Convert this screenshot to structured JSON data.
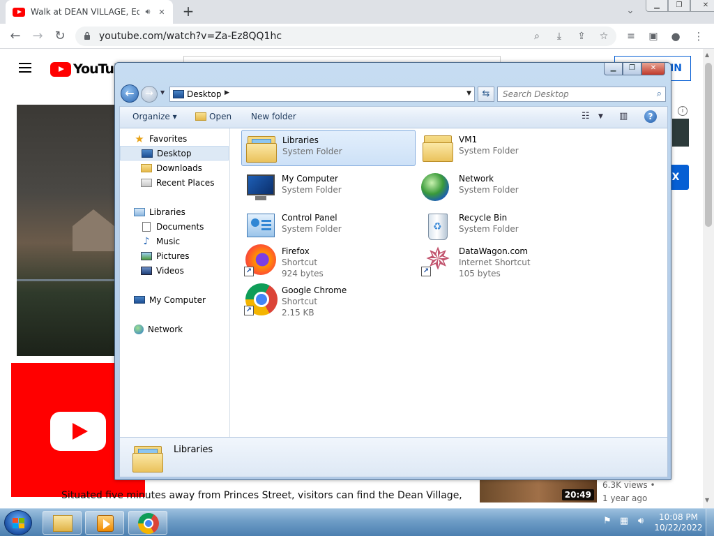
{
  "browser": {
    "tab_title": "Walk at DEAN VILLAGE, Edin",
    "url": "youtube.com/watch?v=Za-Ez8QQ1hc",
    "colors": {
      "tabstrip": "#dee1e6",
      "youtube_red": "#ff0000"
    }
  },
  "youtube": {
    "logo_text": "YouTube",
    "sign_in_label": "IN",
    "x_button_label": "X",
    "description": "Situated five minutes away from Princes Street, visitors can find the Dean Village, a beautiful",
    "recommended": {
      "duration": "20:49",
      "views": "6.3K views •",
      "age": "1 year ago"
    }
  },
  "explorer": {
    "address_crumb": "Desktop",
    "search_placeholder": "Search Desktop",
    "commands": {
      "organize": "Organize",
      "open": "Open",
      "new_folder": "New folder"
    },
    "nav": {
      "favorites": "Favorites",
      "desktop": "Desktop",
      "downloads": "Downloads",
      "recent_places": "Recent Places",
      "libraries": "Libraries",
      "documents": "Documents",
      "music": "Music",
      "pictures": "Pictures",
      "videos": "Videos",
      "my_computer": "My Computer",
      "network": "Network"
    },
    "items": [
      {
        "name": "Libraries",
        "type": "System Folder"
      },
      {
        "name": "VM1",
        "type": "System Folder"
      },
      {
        "name": "My Computer",
        "type": "System Folder"
      },
      {
        "name": "Network",
        "type": "System Folder"
      },
      {
        "name": "Control Panel",
        "type": "System Folder"
      },
      {
        "name": "Recycle Bin",
        "type": "System Folder"
      },
      {
        "name": "Firefox",
        "type": "Shortcut",
        "size": "924 bytes"
      },
      {
        "name": "DataWagon.com",
        "type": "Internet Shortcut",
        "size": "105 bytes"
      },
      {
        "name": "Google Chrome",
        "type": "Shortcut",
        "size": "2.15 KB"
      }
    ],
    "details": {
      "selected_name": "Libraries"
    }
  },
  "taskbar": {
    "time": "10:08 PM",
    "date": "10/22/2022"
  }
}
